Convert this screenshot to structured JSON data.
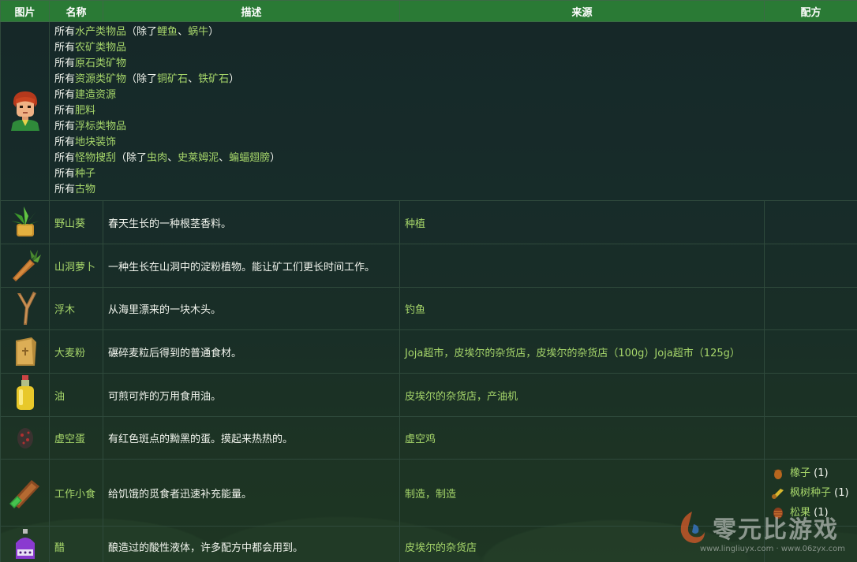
{
  "header": [
    "图片",
    "名称",
    "描述",
    "来源",
    "配方"
  ],
  "first_row": {
    "lines": [
      {
        "pre": "所有",
        "link": "水产类物品",
        "paren_open": "（除了",
        "items": [
          "鲤鱼",
          "蜗牛"
        ],
        "paren_close": "）"
      },
      {
        "pre": "所有",
        "link": "农矿类物品"
      },
      {
        "pre": "所有",
        "link": "原石类矿物"
      },
      {
        "pre": "所有",
        "link": "资源类矿物",
        "paren_open": "（除了",
        "items": [
          "铜矿石",
          "铁矿石"
        ],
        "paren_close": "）"
      },
      {
        "pre": "所有",
        "link": "建造资源"
      },
      {
        "pre": "所有",
        "link": "肥料"
      },
      {
        "pre": "所有",
        "link": "浮标类物品"
      },
      {
        "pre": "所有",
        "link": "地块装饰"
      },
      {
        "pre": "所有",
        "link": "怪物搜刮",
        "paren_open": "（除了",
        "items": [
          "虫肉",
          "史莱姆泥",
          "蝙蝠翅膀"
        ],
        "paren_close": "）"
      },
      {
        "pre": "所有",
        "link": "种子"
      },
      {
        "pre": "所有",
        "link": "古物"
      }
    ]
  },
  "rows": [
    {
      "name": "野山葵",
      "desc": "春天生长的一种根茎香料。",
      "source": "种植",
      "icon": "wild-horseradish-icon"
    },
    {
      "name": "山洞萝卜",
      "desc": "一种生长在山洞中的淀粉植物。能让矿工们更长时间工作。",
      "source": "",
      "icon": "cave-carrot-icon"
    },
    {
      "name": "浮木",
      "desc": "从海里漂来的一块木头。",
      "source": "钓鱼",
      "icon": "driftwood-icon"
    },
    {
      "name": "大麦粉",
      "desc": "碾碎麦粒后得到的普通食材。",
      "source": "Joja超市，皮埃尔的杂货店，皮埃尔的杂货店（100g）Joja超市（125g）",
      "icon": "wheat-flour-icon"
    },
    {
      "name": "油",
      "desc": "可煎可炸的万用食用油。",
      "source": "皮埃尔的杂货店，产油机",
      "icon": "oil-bottle-icon"
    },
    {
      "name": "虚空蛋",
      "desc": "有红色斑点的黝黑的蛋。摸起来热热的。",
      "source": "虚空鸡",
      "icon": "void-egg-icon"
    },
    {
      "name": "工作小食",
      "desc": "给饥饿的觅食者迅速补充能量。",
      "source": "制造，制造",
      "icon": "field-snack-icon",
      "recipe": [
        {
          "name": "橡子",
          "qty": "(1)",
          "icon": "acorn-icon"
        },
        {
          "name": "枫树种子",
          "qty": "(1)",
          "icon": "maple-seed-icon"
        },
        {
          "name": "松果",
          "qty": "(1)",
          "icon": "pine-cone-icon"
        }
      ]
    },
    {
      "name": "醋",
      "desc": "酿造过的酸性液体，许多配方中都会用到。",
      "source": "皮埃尔的杂货店",
      "icon": "vinegar-icon"
    }
  ],
  "watermark": {
    "text": "零元比游戏",
    "url": "www.lingliuyx.com · www.06zyx.com"
  }
}
